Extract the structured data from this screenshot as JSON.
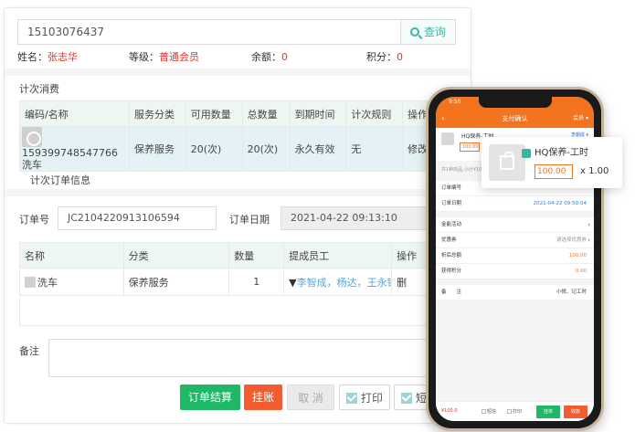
{
  "search": {
    "value": "15103076437",
    "button_label": "查询"
  },
  "member": {
    "name_label": "姓名：",
    "name": "张志华",
    "level_label": "等级：",
    "level": "普通会员",
    "balance_label": "余额：",
    "balance": "0",
    "points_label": "积分：",
    "points": "0"
  },
  "count_consumption": {
    "title": "计次消费",
    "headers": [
      "编码/名称",
      "服务分类",
      "可用数量",
      "总数量",
      "到期时间",
      "计次规则",
      "操作"
    ],
    "row": {
      "code": "159399748547766",
      "name": "洗车",
      "category": "保养服务",
      "available": "20(次)",
      "total": "20(次)",
      "expiry": "永久有效",
      "rule": "无",
      "action": "修改"
    }
  },
  "order_info": {
    "title": "计次订单信息",
    "order_no_label": "订单号",
    "order_no": "JC2104220913106594",
    "order_date_label": "订单日期",
    "order_date": "2021-04-22 09:13:10",
    "headers": [
      "名称",
      "分类",
      "数量",
      "提成员工",
      "操作"
    ],
    "row": {
      "name": "洗车",
      "category": "保养服务",
      "qty": "1",
      "staff": "李智成，杨达，王永锋",
      "action": "删"
    },
    "remark_label": "备注"
  },
  "actions": {
    "checkout": "订单结算",
    "hold": "挂账",
    "cancel": "取 消",
    "print": "打印",
    "sms": "短"
  },
  "phone": {
    "time": "9:50",
    "header_title": "支付确认",
    "member_btn": "会员",
    "product_name": "HQ保养-工时",
    "product_price": "100.00",
    "staff_link": "李朝成",
    "tip": "共1种商品,小计¥100",
    "rows": [
      {
        "label": "订单编号",
        "value": "",
        "style": ""
      },
      {
        "label": "订单日期",
        "value": "2021-04-22 09:50:04",
        "style": "blue"
      },
      {
        "label": "金能活动",
        "value": "",
        "style": "arrow"
      },
      {
        "label": "优惠券",
        "value": "请选择优惠券",
        "style": "gray"
      },
      {
        "label": "折后总额",
        "value": "100.00",
        "style": "orange"
      },
      {
        "label": "获得积分",
        "value": "0.00",
        "style": "orange"
      },
      {
        "label": "备　　注",
        "value": "小修、记工时",
        "style": ""
      }
    ],
    "footer_total": "¥100.0",
    "footer_sms": "短信",
    "footer_print": "打印",
    "footer_hold": "挂单",
    "footer_pay": "收款"
  },
  "card": {
    "title": "HQ保养-工时",
    "price": "100.00",
    "qty": "x 1.00"
  },
  "colors": {
    "accent": "#3ab5a4",
    "red": "#e6322d",
    "green": "#1fb866",
    "orange": "#f25c2f",
    "phone_header": "#f4731f"
  }
}
